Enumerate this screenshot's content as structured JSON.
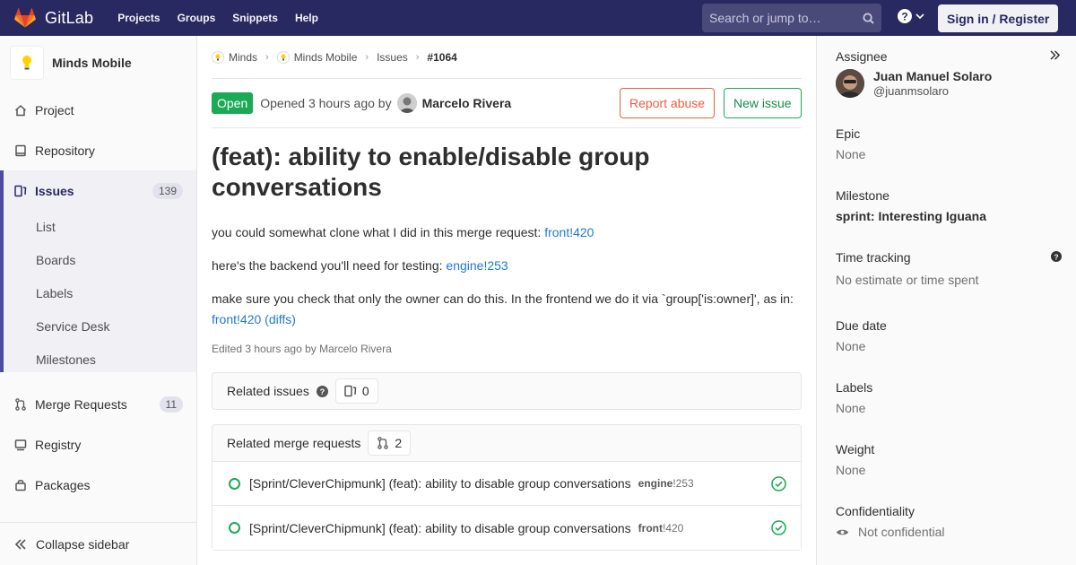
{
  "navbar": {
    "brand": "GitLab",
    "links": [
      "Projects",
      "Groups",
      "Snippets",
      "Help"
    ],
    "search_placeholder": "Search or jump to…",
    "signin_label": "Sign in / Register",
    "colors": {
      "bar": "#292961",
      "logo_orange": "#e24329",
      "logo_light": "#fca326"
    }
  },
  "sidebar": {
    "project_name": "Minds Mobile",
    "items": [
      {
        "label": "Project",
        "icon": "home-icon"
      },
      {
        "label": "Repository",
        "icon": "doc-icon"
      },
      {
        "label": "Issues",
        "icon": "issues-icon",
        "count": "139",
        "active": true
      },
      {
        "label": "Merge Requests",
        "icon": "merge-icon",
        "count": "11"
      },
      {
        "label": "Registry",
        "icon": "container-icon"
      },
      {
        "label": "Packages",
        "icon": "package-icon"
      }
    ],
    "issues_sub": [
      "List",
      "Boards",
      "Labels",
      "Service Desk",
      "Milestones"
    ],
    "collapse_label": "Collapse sidebar"
  },
  "breadcrumb": [
    "Minds",
    "Minds Mobile",
    "Issues",
    "#1064"
  ],
  "issue": {
    "status": "Open",
    "opened_text": "Opened 3 hours ago by",
    "author": "Marcelo Rivera",
    "report_label": "Report abuse",
    "new_label": "New issue",
    "title": "(feat): ability to enable/disable group conversations",
    "desc": {
      "p1_text": "you could somewhat clone what I did in this merge request: ",
      "p1_link": "front!420",
      "p2_text": "here's the backend you'll need for testing: ",
      "p2_link": "engine!253",
      "p3_text": "make sure you check that only the owner can do this. In the frontend we do it via `group['is:owner]', as in:",
      "p3_link": "front!420 (diffs)"
    },
    "edited": "Edited 3 hours ago by Marcelo Rivera"
  },
  "related_issues": {
    "label": "Related issues",
    "count": "0"
  },
  "related_mrs": {
    "label": "Related merge requests",
    "count": "2",
    "items": [
      {
        "title": "[Sprint/CleverChipmunk] (feat): ability to disable group conversations",
        "ref_project": "engine",
        "ref_id": "!253"
      },
      {
        "title": "[Sprint/CleverChipmunk] (feat): ability to disable group conversations",
        "ref_project": "front",
        "ref_id": "!420"
      }
    ]
  },
  "right_sidebar": {
    "assignee": {
      "title": "Assignee",
      "name": "Juan Manuel Solaro",
      "username": "@juanmsolaro"
    },
    "epic": {
      "title": "Epic",
      "value": "None"
    },
    "milestone": {
      "title": "Milestone",
      "value": "sprint: Interesting Iguana"
    },
    "time": {
      "title": "Time tracking",
      "value": "No estimate or time spent"
    },
    "due": {
      "title": "Due date",
      "value": "None"
    },
    "labels": {
      "title": "Labels",
      "value": "None"
    },
    "weight": {
      "title": "Weight",
      "value": "None"
    },
    "confidentiality": {
      "title": "Confidentiality",
      "value": "Not confidential"
    }
  }
}
